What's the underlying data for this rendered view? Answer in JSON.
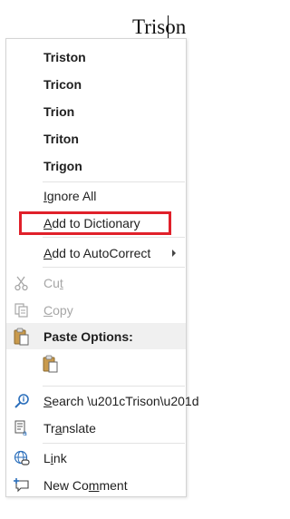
{
  "document": {
    "word_before_cursor": "Triso",
    "word_after_cursor": "n"
  },
  "context_menu": {
    "suggestions": [
      "Triston",
      "Tricon",
      "Trion",
      "Triton",
      "Trigon"
    ],
    "ignore_all": {
      "label": "Ignore All",
      "accel": "I"
    },
    "add_to_dictionary": {
      "label": "Add to Dictionary",
      "accel": "A"
    },
    "add_to_autocorrect": {
      "label": "Add to AutoCorrect",
      "accel": "A"
    },
    "cut": {
      "label": "Cut",
      "accel": "t",
      "disabled": true
    },
    "copy": {
      "label": "Copy",
      "accel": "C",
      "disabled": true
    },
    "paste_options": {
      "label": "Paste Options:"
    },
    "search": {
      "label": "Search “Trison”",
      "accel": "S"
    },
    "translate": {
      "label": "Translate",
      "accel": "a"
    },
    "link": {
      "label": "Link",
      "accel": "i"
    },
    "new_comment": {
      "label": "New Comment",
      "accel": "m"
    }
  },
  "colors": {
    "highlight_border": "#e0202a",
    "disabled_text": "#a6a6a6",
    "spell_squiggle": "#e02020",
    "paste_header_bg": "#f0f0f0"
  },
  "icons": [
    "cut-icon",
    "copy-icon",
    "paste-icon",
    "keep-text-paste-icon",
    "search-icon",
    "translate-icon",
    "link-icon",
    "new-comment-icon",
    "submenu-arrow-icon"
  ]
}
